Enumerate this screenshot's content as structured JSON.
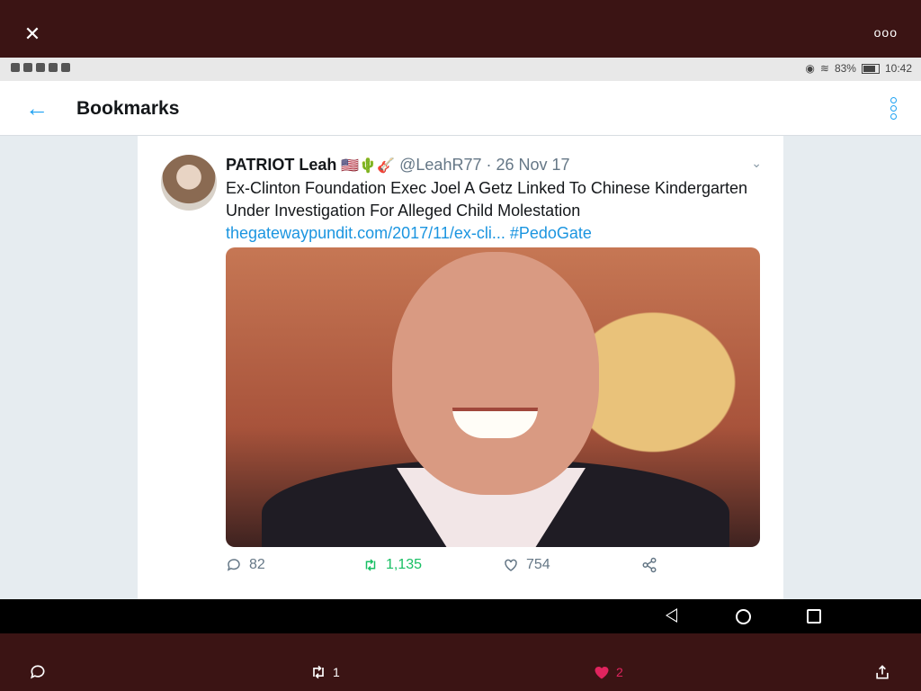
{
  "viewer": {
    "close_icon": "close-icon",
    "more_icon": "more-dots-icon",
    "more_label": "ooo"
  },
  "status_bar": {
    "left_icons": [
      "notification-icon",
      "check-icon",
      "youtube-icon",
      "twitter-icon",
      "messenger-icon"
    ],
    "battery_percent": "83%",
    "battery_level": 0.83,
    "time": "10:42"
  },
  "header": {
    "title": "Bookmarks",
    "accent_color": "#1da1f2"
  },
  "tweet": {
    "display_name": "PATRIOT Leah",
    "emojis": "🇺🇸🌵🎸",
    "handle": "@LeahR77",
    "separator": "·",
    "date": "26 Nov 17",
    "text": "Ex-Clinton Foundation Exec Joel A Getz Linked To Chinese Kindergarten Under Investigation For Alleged Child Molestation",
    "link": "thegatewaypundit.com/2017/11/ex-cli...",
    "hashtag": "#PedoGate",
    "replies": "82",
    "retweets": "1,135",
    "likes": "754"
  },
  "viewer_bottom": {
    "retweet_count": "1",
    "like_count": "2",
    "like_color": "#e0245e"
  }
}
